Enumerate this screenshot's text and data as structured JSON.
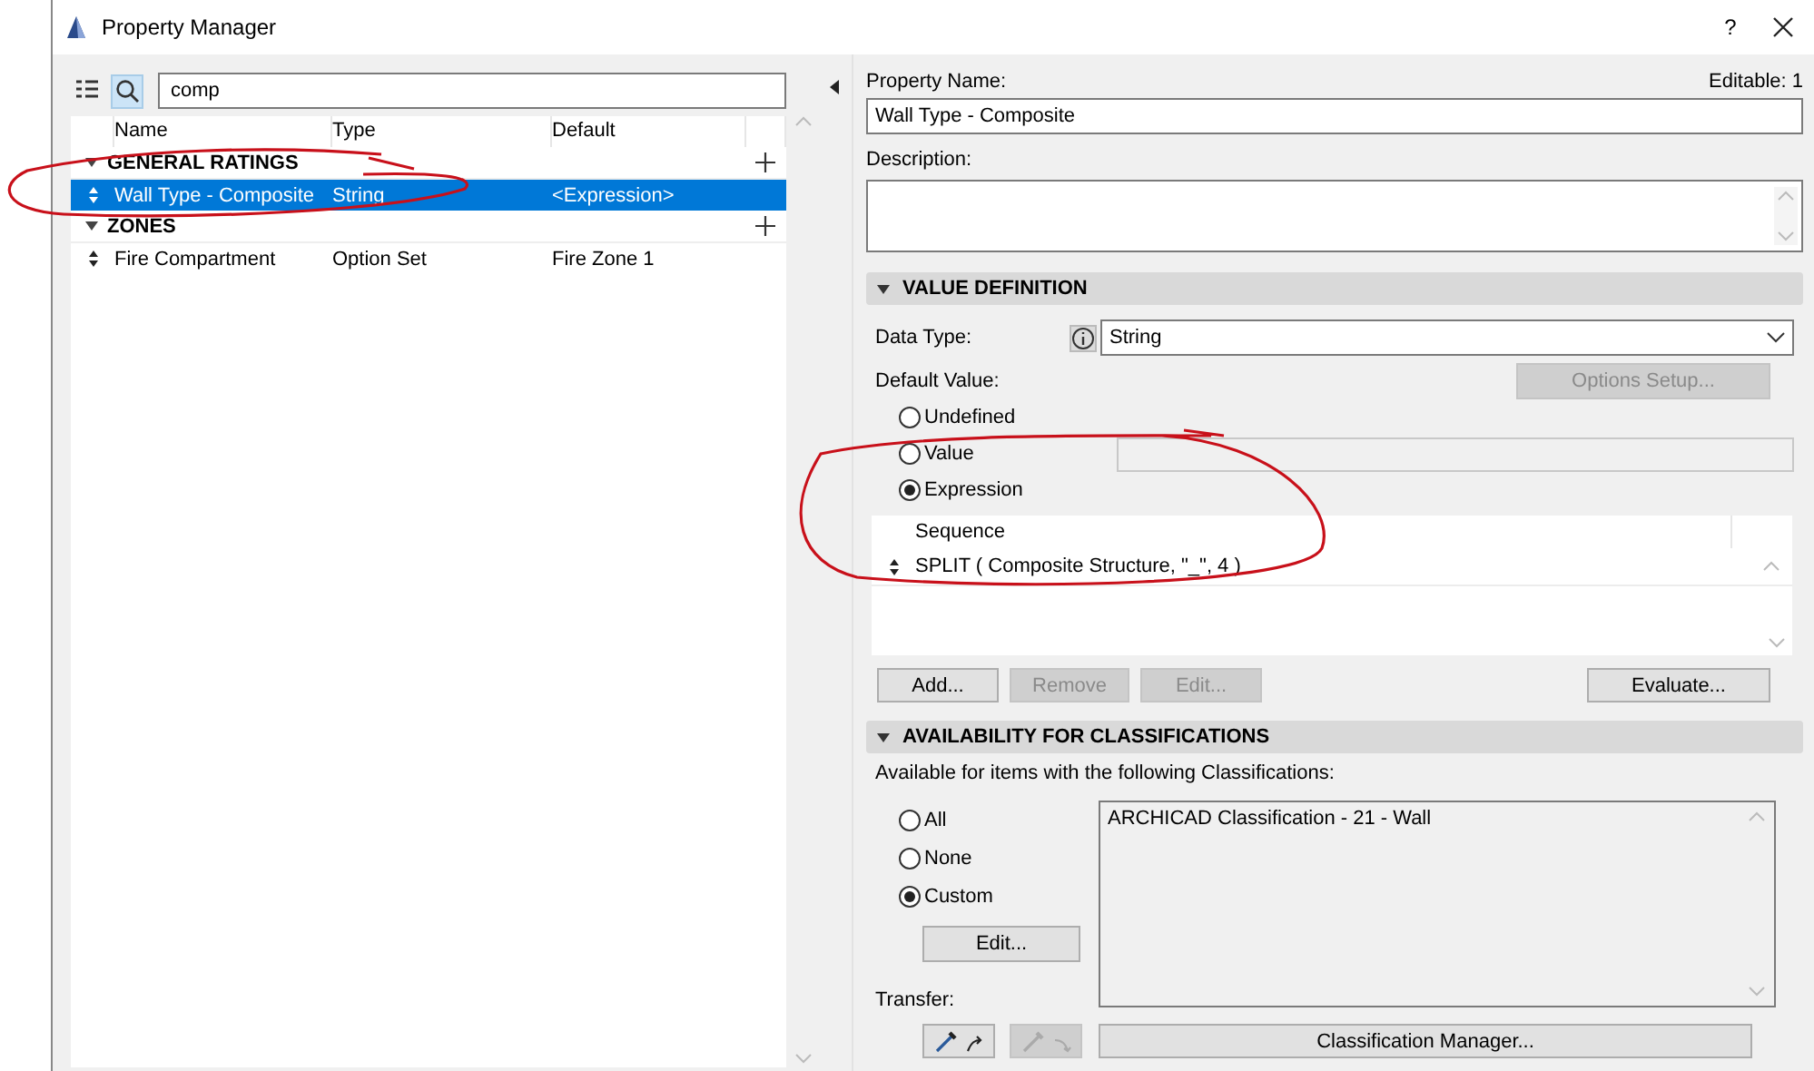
{
  "window": {
    "title": "Property Manager",
    "help": "?"
  },
  "left": {
    "view_toggles": [
      {
        "kind": "list",
        "selected": false
      },
      {
        "kind": "search",
        "selected": true
      }
    ],
    "search": {
      "value": "comp"
    },
    "columns": [
      "Name",
      "Type",
      "Default"
    ],
    "groups": [
      {
        "name": "GENERAL RATINGS",
        "expanded": true,
        "children": [
          {
            "name": "Wall Type - Composite",
            "type": "String",
            "default": "<Expression>",
            "selected": true
          }
        ]
      },
      {
        "name": "ZONES",
        "expanded": true,
        "children": [
          {
            "name": "Fire Compartment",
            "type": "Option Set",
            "default": "Fire Zone 1",
            "selected": false
          }
        ]
      }
    ]
  },
  "right": {
    "property_name": {
      "label": "Property Name:",
      "value": "Wall Type - Composite"
    },
    "editable": "Editable: 1",
    "description": {
      "label": "Description:"
    },
    "value_definition": {
      "title": "VALUE DEFINITION",
      "expanded": true,
      "data_type": {
        "label": "Data Type:",
        "value": "String"
      },
      "default_value_label": "Default Value:",
      "options_setup": {
        "label": "Options Setup...",
        "disabled": true
      },
      "default_options": [
        {
          "label": "Undefined",
          "selected": false
        },
        {
          "label": "Value",
          "selected": false
        },
        {
          "label": "Expression",
          "selected": true
        }
      ],
      "sequence": {
        "column": "Sequence",
        "rows": [
          "SPLIT ( Composite Structure, \"_\", 4 )"
        ]
      },
      "buttons": [
        {
          "label": "Add...",
          "disabled": false
        },
        {
          "label": "Remove",
          "disabled": true
        },
        {
          "label": "Edit...",
          "disabled": true
        },
        {
          "label": "Evaluate...",
          "disabled": false
        }
      ]
    },
    "availability": {
      "title": "AVAILABILITY FOR CLASSIFICATIONS",
      "expanded": true,
      "caption": "Available for items with the following Classifications:",
      "options": [
        {
          "label": "All",
          "selected": false
        },
        {
          "label": "None",
          "selected": false
        },
        {
          "label": "Custom",
          "selected": true
        }
      ],
      "edit_button": {
        "label": "Edit..."
      },
      "classifications": [
        "ARCHICAD Classification - 21 - Wall"
      ],
      "transfer_label": "Transfer:",
      "transfer_buttons": [
        {
          "kind": "copy",
          "disabled": false
        },
        {
          "kind": "paste",
          "disabled": true
        }
      ],
      "manager_button": {
        "label": "Classification Manager..."
      }
    }
  }
}
